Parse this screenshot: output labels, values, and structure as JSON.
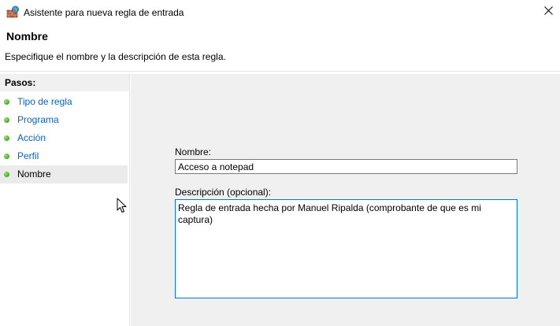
{
  "window": {
    "title": "Asistente para nueva regla de entrada"
  },
  "header": {
    "title": "Nombre",
    "description": "Especifique el nombre y la descripción de esta regla."
  },
  "steps": {
    "header": "Pasos:",
    "items": [
      {
        "label": "Tipo de regla",
        "active": false
      },
      {
        "label": "Programa",
        "active": false
      },
      {
        "label": "Acción",
        "active": false
      },
      {
        "label": "Perfil",
        "active": false
      },
      {
        "label": "Nombre",
        "active": true
      }
    ]
  },
  "form": {
    "name_label": "Nombre:",
    "name_value": "Acceso a notepad",
    "description_label": "Descripción (opcional):",
    "description_value": "Regla de entrada hecha por Manuel Ripalda (comprobante de que es mi captura)"
  },
  "colors": {
    "step_link": "#0066cc",
    "step_dot": "#52b82b",
    "panel_bg": "#f0f0f0",
    "focus_border": "#0078d7"
  }
}
